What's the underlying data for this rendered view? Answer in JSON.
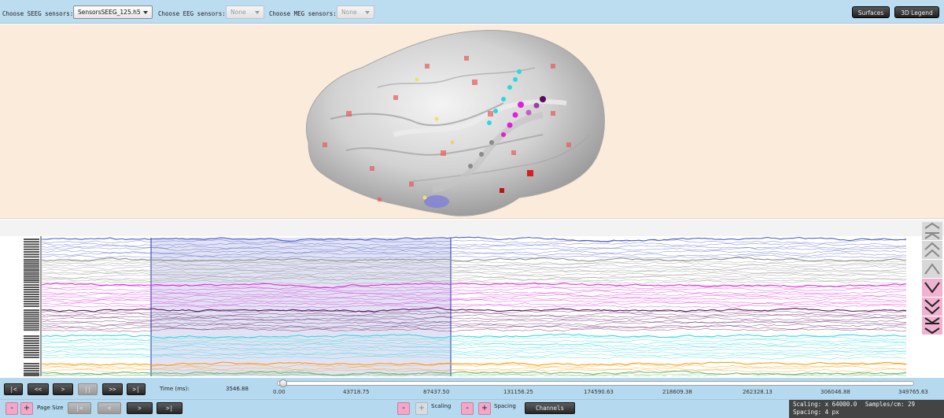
{
  "toolbar": {
    "seeg_label": "Choose SEEG sensors:",
    "seeg_value": "SensorsSEEG_125.h5",
    "eeg_label": "Choose EEG sensors:",
    "eeg_value": "None",
    "meg_label": "Choose MEG sensors:",
    "meg_value": "None",
    "surfaces_label": "Surfaces",
    "legend_label": "3D Legend"
  },
  "colors": {
    "toolbar_bg": "#bcdcf0",
    "viewer_bg": "#fbebdb",
    "selection_fill": "#bcc0e6",
    "series": [
      "#4a59c4",
      "#8a8a8a",
      "#e020d8",
      "#5a0a5a",
      "#2ad8e0",
      "#ff9900",
      "#66bb66"
    ]
  },
  "playback": {
    "buttons": [
      "|<",
      "<<",
      ">",
      "||",
      ">>",
      ">|"
    ],
    "time_label": "Time (ms):",
    "time_value": "3546.88",
    "axis_ticks": [
      "0.00",
      "43718.75",
      "87437.50",
      "131156.25",
      "174590.63",
      "218609.38",
      "262328.13",
      "306046.88",
      "349765.63"
    ]
  },
  "paging": {
    "minus": "-",
    "plus": "+",
    "page_size_label": "Page Size",
    "first": "|<",
    "prev": "<",
    "next": ">",
    "last": ">|",
    "scaling_label": "Scaling",
    "spacing_label": "Spacing",
    "channels_label": "Channels"
  },
  "status": {
    "scaling": "Scaling: x 64000.0",
    "samples": "Samples/cm: 29",
    "spacing": "Spacing: 4 px"
  },
  "nav_icons": [
    "double-chevron-up-icon",
    "chevron-up-pair-icon",
    "chevron-up-icon",
    "chevron-down-icon",
    "chevron-down-pair-icon",
    "double-chevron-down-icon"
  ]
}
